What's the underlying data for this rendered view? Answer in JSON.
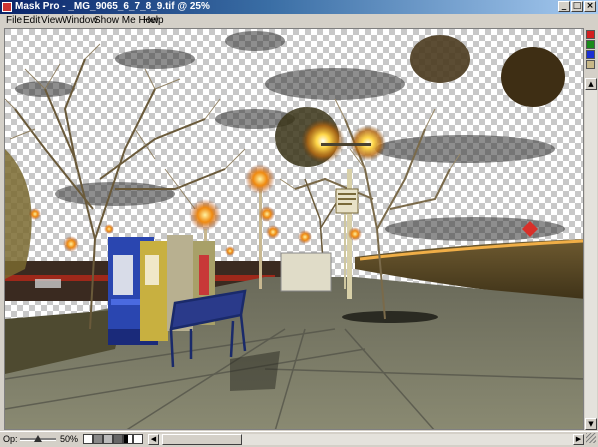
{
  "window": {
    "title": "Mask Pro - _MG_9065_6_7_8_9.tif @ 25%",
    "minimize_glyph": "_",
    "maximize_glyph": "□",
    "close_glyph": "×"
  },
  "menu": {
    "items": [
      {
        "label": "File"
      },
      {
        "label": "Edit"
      },
      {
        "label": "View"
      },
      {
        "label": "Window"
      },
      {
        "label": "Show Me How"
      },
      {
        "label": "Help"
      }
    ]
  },
  "side_toolbar": {
    "swatches": [
      {
        "name": "red-swatch",
        "color": "#d32020"
      },
      {
        "name": "green-swatch",
        "color": "#1a8a1a"
      },
      {
        "name": "blue-swatch",
        "color": "#1a2fd3"
      },
      {
        "name": "pattern-swatch",
        "color": "#c8b888"
      }
    ]
  },
  "status": {
    "opacity_label": "Op:",
    "opacity_value_label": "50%",
    "opacity_fraction": 0.5,
    "view_icons": [
      "grid-icon",
      "mask-view-icon",
      "image-view-icon",
      "overlay-view-icon",
      "bw-view-icon",
      "fit-view-icon",
      "zoom-icon"
    ]
  },
  "scrollbars": {
    "up_glyph": "▲",
    "down_glyph": "▼",
    "left_glyph": "◀",
    "right_glyph": "▶"
  },
  "colors": {
    "titlebar_start": "#0a246a",
    "titlebar_end": "#a6caf0",
    "chrome": "#d4d0c8"
  }
}
